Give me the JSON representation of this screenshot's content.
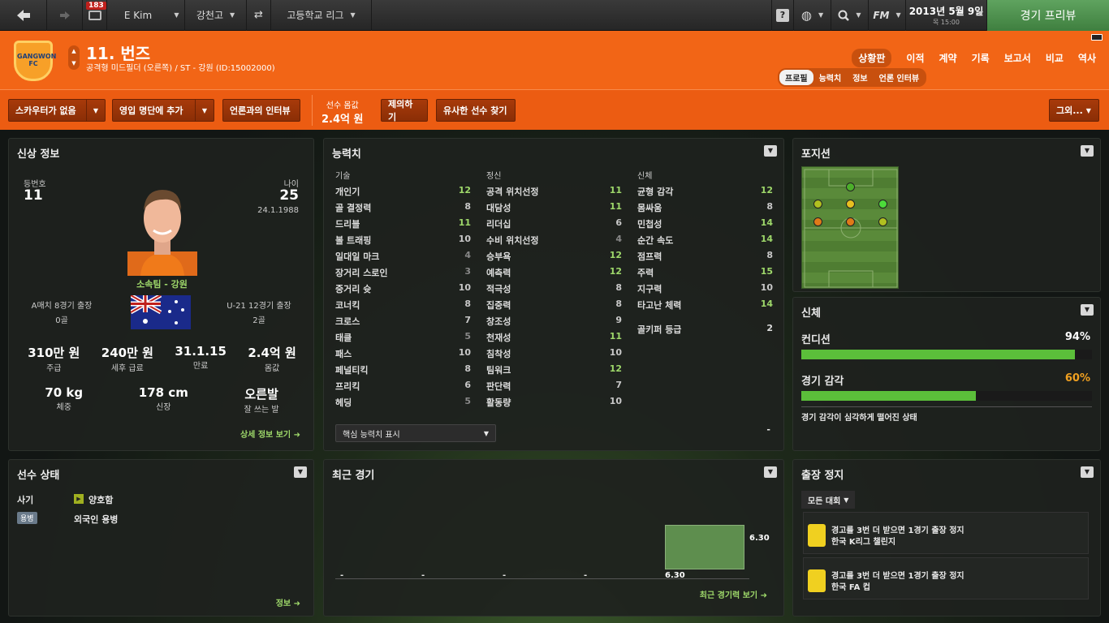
{
  "topbar": {
    "inbox_count": "183",
    "manager": "E Kim",
    "club": "강천고",
    "league": "고등학교 리그",
    "date": "2013년 5월 9일",
    "time": "목 15:00",
    "preview": "경기 프리뷰",
    "fm_label": "FM"
  },
  "player": {
    "name": "11. 번즈",
    "desc": "공격형 미드필더 (오른쪽) / ST - 강원 (ID:15002000)",
    "badge": "GANGWON FC"
  },
  "nav": {
    "items": [
      "상황판",
      "이적",
      "계약",
      "기록",
      "보고서",
      "비교",
      "역사"
    ],
    "sub": [
      "프로필",
      "능력치",
      "정보",
      "언론 인터뷰"
    ]
  },
  "actions": {
    "scout": "스카우터가 없음",
    "shortlist": "영입 명단에 추가",
    "interview": "언론과의 인터뷰",
    "value_label": "선수 몸값",
    "value": "2.4억 원",
    "offer": "제의하기",
    "similar": "유사한 선수 찾기",
    "other": "그외..."
  },
  "bio": {
    "title": "신상 정보",
    "num_label": "등번호",
    "num": "11",
    "age_label": "나이",
    "age": "25",
    "dob": "24.1.1988",
    "club": "소속팀 - 강원",
    "caps": "A매치 8경기 출장",
    "caps_goals": "0골",
    "u21": "U-21 12경기 출장",
    "u21_goals": "2골",
    "stats": [
      {
        "v": "310만 원",
        "l": "주급"
      },
      {
        "v": "240만 원",
        "l": "세후 급료"
      },
      {
        "v": "31.1.15",
        "l": "만료"
      },
      {
        "v": "2.4억 원",
        "l": "몸값"
      }
    ],
    "stats2": [
      {
        "v": "70 kg",
        "l": "체중"
      },
      {
        "v": "178 cm",
        "l": "신장"
      },
      {
        "v": "오른발",
        "l": "잘 쓰는 발"
      }
    ],
    "more": "상세 정보 보기 ➜"
  },
  "attr": {
    "title": "능력치",
    "col1": "기술",
    "col2": "정신",
    "col3": "신체",
    "tech": [
      [
        "개인기",
        "12"
      ],
      [
        "골 결정력",
        "8"
      ],
      [
        "드리블",
        "11"
      ],
      [
        "볼 트래핑",
        "10"
      ],
      [
        "일대일 마크",
        "4"
      ],
      [
        "장거리 스로인",
        "3"
      ],
      [
        "중거리 슛",
        "10"
      ],
      [
        "코너킥",
        "8"
      ],
      [
        "크로스",
        "7"
      ],
      [
        "태클",
        "5"
      ],
      [
        "패스",
        "10"
      ],
      [
        "페널티킥",
        "8"
      ],
      [
        "프리킥",
        "6"
      ],
      [
        "헤딩",
        "5"
      ]
    ],
    "mental": [
      [
        "공격 위치선정",
        "11"
      ],
      [
        "대담성",
        "11"
      ],
      [
        "리더십",
        "6"
      ],
      [
        "수비 위치선정",
        "4"
      ],
      [
        "승부욕",
        "12"
      ],
      [
        "예측력",
        "12"
      ],
      [
        "적극성",
        "8"
      ],
      [
        "집중력",
        "8"
      ],
      [
        "창조성",
        "9"
      ],
      [
        "천재성",
        "11"
      ],
      [
        "침착성",
        "10"
      ],
      [
        "팀워크",
        "12"
      ],
      [
        "판단력",
        "7"
      ],
      [
        "활동량",
        "10"
      ]
    ],
    "phys": [
      [
        "균형 감각",
        "12"
      ],
      [
        "몸싸움",
        "8"
      ],
      [
        "민첩성",
        "14"
      ],
      [
        "순간 속도",
        "14"
      ],
      [
        "점프력",
        "8"
      ],
      [
        "주력",
        "15"
      ],
      [
        "지구력",
        "10"
      ],
      [
        "타고난 체력",
        "14"
      ]
    ],
    "gk_label": "골키퍼 등급",
    "gk": "2",
    "select": "핵심 능력치 표시",
    "dash": "-"
  },
  "position": {
    "title": "포지션"
  },
  "physical": {
    "title": "신체",
    "cond_label": "컨디션",
    "cond": "94%",
    "cond_pct": 0.94,
    "sharp_label": "경기 감각",
    "sharp": "60%",
    "sharp_pct": 0.6,
    "note": "경기 감각이 심각하게 떨어진 상태"
  },
  "status": {
    "title": "선수 상태",
    "morale_label": "사기",
    "morale": "양호함",
    "foreign_tag": "용병",
    "foreign": "외국인 용병",
    "link": "정보 ➜"
  },
  "recent": {
    "title": "최근 경기",
    "value": "6.30",
    "value2": "6.30",
    "dashes": [
      "-",
      "-",
      "-",
      "-"
    ],
    "link": "최근 경기력 보기 ➜"
  },
  "ban": {
    "title": "출장 정지",
    "filter": "모든 대회",
    "items": [
      {
        "t": "경고를 3번 더 받으면 1경기 출장 정지",
        "c": "한국 K리그 챌린지"
      },
      {
        "t": "경고를 3번 더 받으면 1경기 출장 정지",
        "c": "한국 FA 컵"
      }
    ]
  },
  "colors": {
    "orange": "#f26516",
    "green": "#9ed86a",
    "bar": "#5bbf3a"
  }
}
